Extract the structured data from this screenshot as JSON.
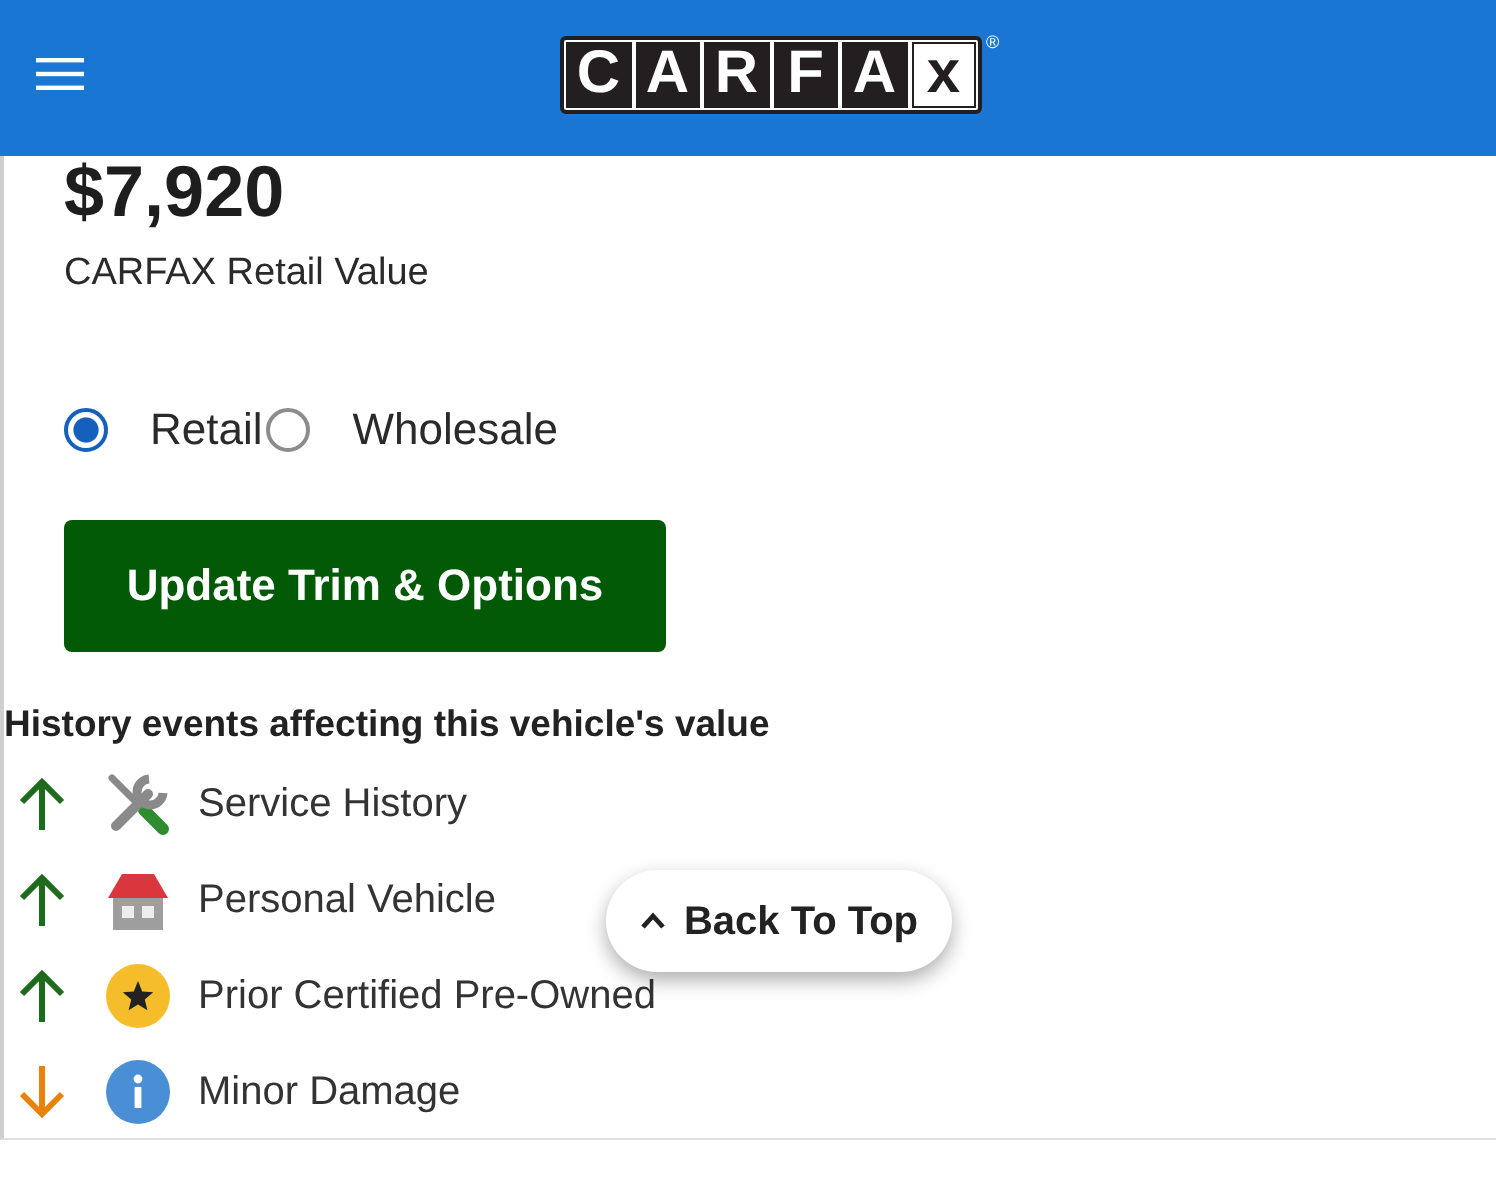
{
  "header": {
    "logo": {
      "letters": [
        {
          "char": "C",
          "inverted": false
        },
        {
          "char": "A",
          "inverted": false
        },
        {
          "char": "R",
          "inverted": false
        },
        {
          "char": "F",
          "inverted": false
        },
        {
          "char": "A",
          "inverted": false
        },
        {
          "char": "x",
          "inverted": true
        }
      ],
      "mark": "®"
    }
  },
  "value": {
    "price": "$7,920",
    "label": "CARFAX Retail Value"
  },
  "value_types": [
    {
      "label": "Retail",
      "selected": true
    },
    {
      "label": "Wholesale",
      "selected": false
    }
  ],
  "update_button": {
    "label": "Update Trim & Options"
  },
  "history": {
    "title": "History events affecting this vehicle's value",
    "events": [
      {
        "kind": "service",
        "increases_value": true,
        "label": "Service History"
      },
      {
        "kind": "personal",
        "increases_value": true,
        "label": "Personal Vehicle"
      },
      {
        "kind": "certified",
        "increases_value": true,
        "label": "Prior Certified Pre-Owned"
      },
      {
        "kind": "damage",
        "increases_value": false,
        "label": "Minor Damage"
      }
    ]
  },
  "back_to_top": {
    "label": "Back To Top"
  }
}
